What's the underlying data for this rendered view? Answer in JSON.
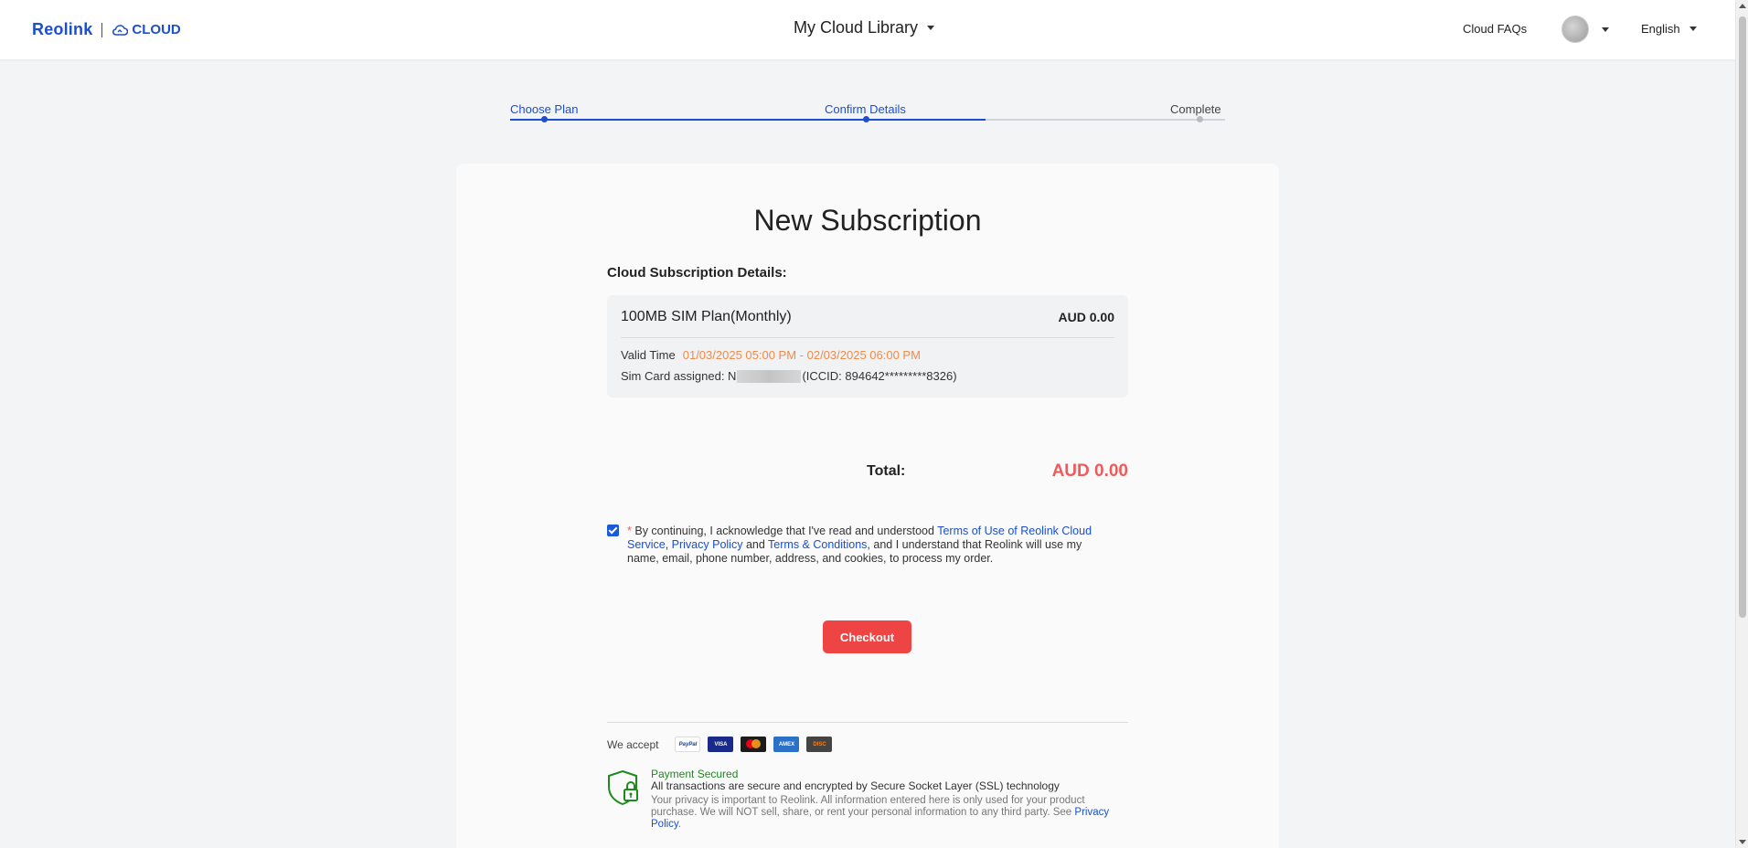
{
  "header": {
    "logo_text": "Reolink",
    "logo_cloud": "CLOUD",
    "library_title": "My Cloud Library",
    "faq_link": "Cloud FAQs",
    "language": "English"
  },
  "steps": [
    {
      "label": "Choose Plan",
      "state": "done"
    },
    {
      "label": "Confirm Details",
      "state": "active"
    },
    {
      "label": "Complete",
      "state": "pending"
    }
  ],
  "main": {
    "title": "New Subscription",
    "section_title": "Cloud Subscription Details:",
    "plan": {
      "name": "100MB SIM Plan(Monthly)",
      "price": "AUD 0.00",
      "valid_label": "Valid Time",
      "valid_value": "01/03/2025 05:00 PM - 02/03/2025 06:00 PM",
      "sim_label": "Sim Card assigned: N",
      "sim_suffix": "(ICCID: 894642*********8326)"
    },
    "total_label": "Total:",
    "total_value": "AUD 0.00",
    "agreement": {
      "checked": true,
      "required_mark": "*",
      "text_before": "By continuing, I acknowledge that I've read and understood",
      "link_terms": "Terms of Use of Reolink Cloud Service",
      "comma": ",",
      "link_privacy": "Privacy Policy",
      "and": "and",
      "link_conditions": "Terms & Conditions",
      "text_after": ", and I understand that Reolink will use my name, email, phone number, address, and cookies, to process my order."
    },
    "checkout_label": "Checkout",
    "payments": {
      "label": "We accept",
      "methods": [
        "PayPal",
        "VISA",
        "mastercard",
        "AMERICAN EXPRESS",
        "DISCOVER"
      ]
    },
    "security": {
      "title": "Payment Secured",
      "line1": "All transactions are secure and encrypted by Secure Socket Layer (SSL) technology",
      "line2": "Your privacy is important to Reolink. All information entered here is only used for your product purchase. We will NOT sell, share, or rent your personal information to any third party. See",
      "privacy_link": "Privacy Policy",
      "period": "."
    }
  },
  "colors": {
    "brand_blue": "#1a4fd1",
    "accent_red": "#ef4444",
    "total_red": "#ef5a5a",
    "valid_orange": "#f08a4b",
    "secure_green": "#1c8a1c"
  }
}
